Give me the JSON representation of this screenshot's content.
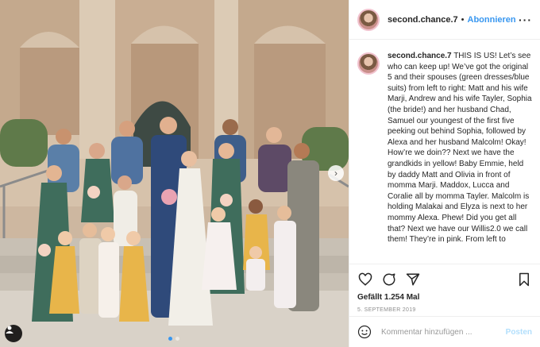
{
  "post": {
    "username": "second.chance.7",
    "follow_label": "Abonnieren",
    "more_icon": "more-horizontal-icon"
  },
  "caption": {
    "username": "second.chance.7",
    "text": "THIS IS US! Let’s see who can keep up! We’ve got the original 5 and their spouses (green dresses/blue suits) from left to right: Matt and his wife Marji, Andrew and his wife Tayler, Sophia (the bride!) and her husband Chad, Samuel our youngest of the first five peeking out behind Sophia, followed by Alexa and her husband Malcolm! Okay! How’re we doin?? Next we have the grandkids in yellow! Baby Emmie, held by daddy Matt and Olivia in front of momma Marji. Maddox, Lucca and Coralie all by momma Tayler. Malcolm is holding Malakai and Elyza is next to her mommy Alexa. Phew! Did you get all that? Next we have our Willis2.0 we call them! They’re in pink. From left to"
  },
  "actions": {
    "like_icon": "heart-icon",
    "comment_icon": "comment-icon",
    "share_icon": "share-icon",
    "save_icon": "bookmark-icon",
    "likes_text": "Gefällt 1.254 Mal",
    "date": "5. SEPTEMBER 2019"
  },
  "comment": {
    "placeholder": "Kommentar hinzufügen ...",
    "post_label": "Posten",
    "emoji_icon": "smiley-icon"
  },
  "photo": {
    "next_icon": "chevron-right-icon",
    "tag_icon": "user-tag-icon",
    "carousel_dots": 2,
    "accent_color": "#3897f0"
  }
}
